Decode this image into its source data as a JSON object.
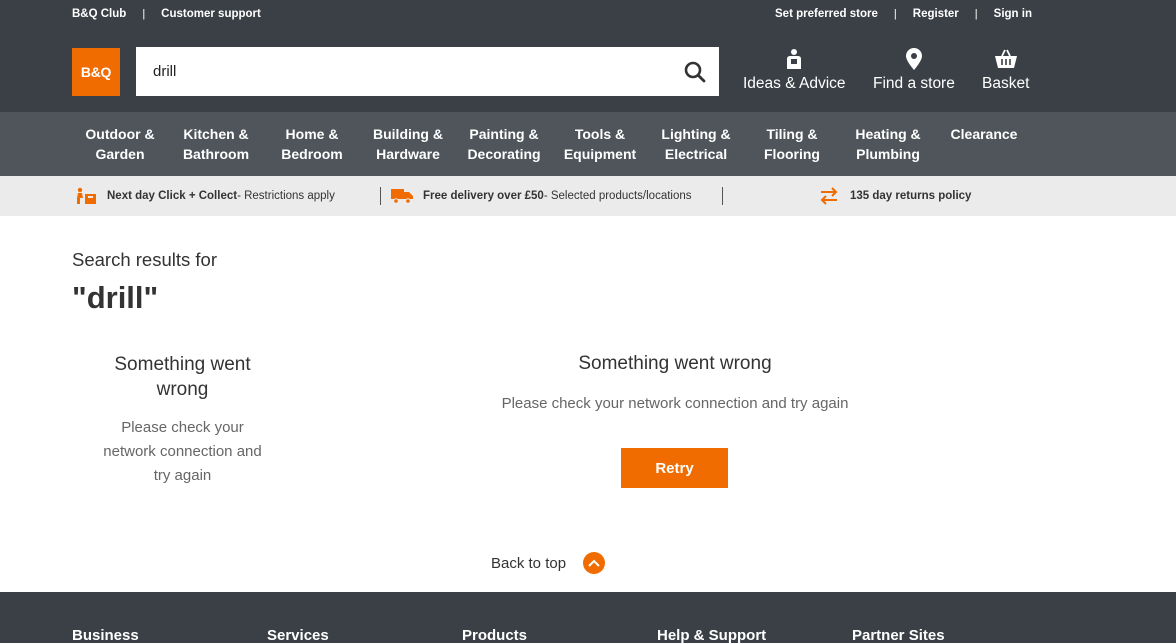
{
  "colors": {
    "brand_orange": "#f06c00",
    "header_dark": "#3b4046",
    "nav_grey": "#4f555b",
    "promo_grey": "#ebebeb"
  },
  "utility": {
    "left": [
      "B&Q Club",
      "Customer support"
    ],
    "right": [
      "Set preferred store",
      "Register",
      "Sign in"
    ],
    "separator": "|"
  },
  "logo": {
    "text": "B&Q"
  },
  "search": {
    "value": "drill",
    "icon": "search-icon"
  },
  "header_actions": [
    {
      "label": "Ideas & Advice",
      "icon": "ideas-icon"
    },
    {
      "label": "Find a store",
      "icon": "location-pin-icon"
    },
    {
      "label": "Basket",
      "icon": "basket-icon"
    }
  ],
  "categories": [
    {
      "line1": "Outdoor &",
      "line2": "Garden"
    },
    {
      "line1": "Kitchen &",
      "line2": "Bathroom"
    },
    {
      "line1": "Home &",
      "line2": "Bedroom"
    },
    {
      "line1": "Building &",
      "line2": "Hardware"
    },
    {
      "line1": "Painting &",
      "line2": "Decorating"
    },
    {
      "line1": "Tools &",
      "line2": "Equipment"
    },
    {
      "line1": "Lighting &",
      "line2": "Electrical"
    },
    {
      "line1": "Tiling &",
      "line2": "Flooring"
    },
    {
      "line1": "Heating &",
      "line2": "Plumbing"
    },
    {
      "line1": "Clearance",
      "line2": ""
    }
  ],
  "promo": [
    {
      "bold": "Next day Click + Collect",
      "rest": " - Restrictions apply",
      "icon": "click-collect-icon"
    },
    {
      "bold": "Free delivery over £50",
      "rest": " - Selected products/locations",
      "icon": "delivery-van-icon"
    },
    {
      "bold": "135 day returns policy",
      "rest": "",
      "icon": "returns-arrows-icon"
    }
  ],
  "results": {
    "heading": "Search results for",
    "query": "\"drill\""
  },
  "error_left": {
    "title": "Something went wrong",
    "desc": "Please check your network connection and try again"
  },
  "error_main": {
    "title": "Something went wrong",
    "desc": "Please check your network connection and try again",
    "button": "Retry"
  },
  "back_to_top": {
    "label": "Back to top",
    "icon": "chevron-up-icon"
  },
  "footer": {
    "headings": [
      "Business",
      "Services",
      "Products",
      "Help & Support",
      "Partner Sites"
    ]
  }
}
